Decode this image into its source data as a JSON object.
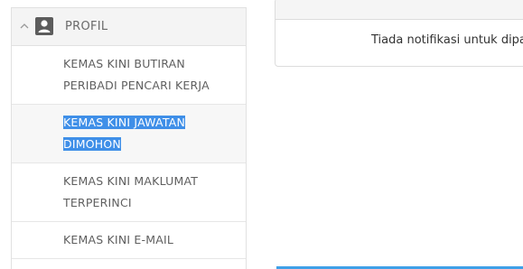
{
  "sidebar": {
    "section": {
      "label": "PROFIL",
      "icon": "user-icon",
      "toggle_icon": "chevron-up-icon"
    },
    "items": [
      {
        "label_line1": "KEMAS KINI BUTIRAN",
        "label_line2": "PERIBADI PENCARI KERJA",
        "active": false
      },
      {
        "label_line1": "KEMAS KINI JAWATAN",
        "label_line2": "DIMOHON",
        "active": true,
        "text_selected": true
      },
      {
        "label_line1": "KEMAS KINI MAKLUMAT",
        "label_line2": "TERPERINCI",
        "active": false
      },
      {
        "label_line1": "KEMAS KINI E-MAIL",
        "active": false
      }
    ]
  },
  "notification_card": {
    "message": "Tiada notifikasi untuk dipaparkan"
  },
  "colors": {
    "selection": "#3f8fe8",
    "accent_line": "#3fa0e8",
    "header_bg": "#f4f4f4"
  }
}
